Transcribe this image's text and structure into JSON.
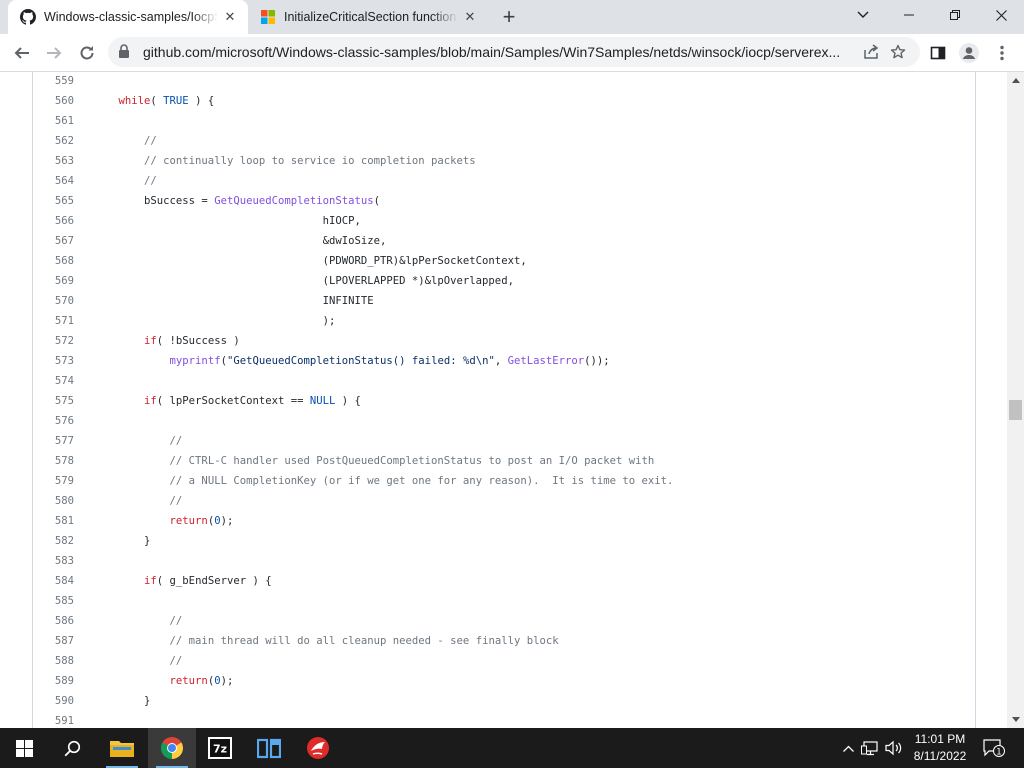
{
  "browser": {
    "tabs": [
      {
        "title": "Windows-classic-samples/IocpServerEx",
        "favicon": "github-icon",
        "active": true
      },
      {
        "title": "InitializeCriticalSection function (synchapi.h)",
        "favicon": "microsoft-icon",
        "active": false
      }
    ],
    "new_tab_label": "+",
    "close_tab_label": "✕",
    "window_controls": [
      "minimize",
      "restore",
      "close"
    ],
    "url": "github.com/microsoft/Windows-classic-samples/blob/main/Samples/Win7Samples/netds/winsock/iocp/serverex..."
  },
  "code": {
    "lines": [
      {
        "n": "559",
        "tokens": []
      },
      {
        "n": "560",
        "tokens": [
          {
            "t": "    "
          },
          {
            "t": "while",
            "c": "kw"
          },
          {
            "t": "( "
          },
          {
            "t": "TRUE",
            "c": "const"
          },
          {
            "t": " ) {"
          }
        ]
      },
      {
        "n": "561",
        "tokens": []
      },
      {
        "n": "562",
        "tokens": [
          {
            "t": "        "
          },
          {
            "t": "//",
            "c": "com"
          }
        ]
      },
      {
        "n": "563",
        "tokens": [
          {
            "t": "        "
          },
          {
            "t": "// continually loop to service io completion packets",
            "c": "com"
          }
        ]
      },
      {
        "n": "564",
        "tokens": [
          {
            "t": "        "
          },
          {
            "t": "//",
            "c": "com"
          }
        ]
      },
      {
        "n": "565",
        "tokens": [
          {
            "t": "        bSuccess = "
          },
          {
            "t": "GetQueuedCompletionStatus",
            "c": "fn"
          },
          {
            "t": "("
          }
        ]
      },
      {
        "n": "566",
        "tokens": [
          {
            "t": "                                    hIOCP,"
          }
        ]
      },
      {
        "n": "567",
        "tokens": [
          {
            "t": "                                    &dwIoSize,"
          }
        ]
      },
      {
        "n": "568",
        "tokens": [
          {
            "t": "                                    (PDWORD_PTR)&lpPerSocketContext,"
          }
        ]
      },
      {
        "n": "569",
        "tokens": [
          {
            "t": "                                    (LPOVERLAPPED *)&lpOverlapped,"
          }
        ]
      },
      {
        "n": "570",
        "tokens": [
          {
            "t": "                                    INFINITE"
          }
        ]
      },
      {
        "n": "571",
        "tokens": [
          {
            "t": "                                    );"
          }
        ]
      },
      {
        "n": "572",
        "tokens": [
          {
            "t": "        "
          },
          {
            "t": "if",
            "c": "kw"
          },
          {
            "t": "( !bSuccess )"
          }
        ]
      },
      {
        "n": "573",
        "tokens": [
          {
            "t": "            "
          },
          {
            "t": "myprintf",
            "c": "fn"
          },
          {
            "t": "(",
            "c": "plain"
          },
          {
            "t": "\"GetQueuedCompletionStatus() failed: %d\\n\"",
            "c": "str"
          },
          {
            "t": ", "
          },
          {
            "t": "GetLastError",
            "c": "fn"
          },
          {
            "t": "());"
          }
        ]
      },
      {
        "n": "574",
        "tokens": []
      },
      {
        "n": "575",
        "tokens": [
          {
            "t": "        "
          },
          {
            "t": "if",
            "c": "kw"
          },
          {
            "t": "( lpPerSocketContext == "
          },
          {
            "t": "NULL",
            "c": "const"
          },
          {
            "t": " ) {"
          }
        ]
      },
      {
        "n": "576",
        "tokens": []
      },
      {
        "n": "577",
        "tokens": [
          {
            "t": "            "
          },
          {
            "t": "//",
            "c": "com"
          }
        ]
      },
      {
        "n": "578",
        "tokens": [
          {
            "t": "            "
          },
          {
            "t": "// CTRL-C handler used PostQueuedCompletionStatus to post an I/O packet with",
            "c": "com"
          }
        ]
      },
      {
        "n": "579",
        "tokens": [
          {
            "t": "            "
          },
          {
            "t": "// a NULL CompletionKey (or if we get one for any reason).  It is time to exit.",
            "c": "com"
          }
        ]
      },
      {
        "n": "580",
        "tokens": [
          {
            "t": "            "
          },
          {
            "t": "//",
            "c": "com"
          }
        ]
      },
      {
        "n": "581",
        "tokens": [
          {
            "t": "            "
          },
          {
            "t": "return",
            "c": "kw"
          },
          {
            "t": "("
          },
          {
            "t": "0",
            "c": "const"
          },
          {
            "t": ");"
          }
        ]
      },
      {
        "n": "582",
        "tokens": [
          {
            "t": "        }"
          }
        ]
      },
      {
        "n": "583",
        "tokens": []
      },
      {
        "n": "584",
        "tokens": [
          {
            "t": "        "
          },
          {
            "t": "if",
            "c": "kw"
          },
          {
            "t": "( g_bEndServer ) {"
          }
        ]
      },
      {
        "n": "585",
        "tokens": []
      },
      {
        "n": "586",
        "tokens": [
          {
            "t": "            "
          },
          {
            "t": "//",
            "c": "com"
          }
        ]
      },
      {
        "n": "587",
        "tokens": [
          {
            "t": "            "
          },
          {
            "t": "// main thread will do all cleanup needed - see finally block",
            "c": "com"
          }
        ]
      },
      {
        "n": "588",
        "tokens": [
          {
            "t": "            "
          },
          {
            "t": "//",
            "c": "com"
          }
        ]
      },
      {
        "n": "589",
        "tokens": [
          {
            "t": "            "
          },
          {
            "t": "return",
            "c": "kw"
          },
          {
            "t": "("
          },
          {
            "t": "0",
            "c": "const"
          },
          {
            "t": ");"
          }
        ]
      },
      {
        "n": "590",
        "tokens": [
          {
            "t": "        }"
          }
        ]
      },
      {
        "n": "591",
        "tokens": []
      }
    ]
  },
  "taskbar": {
    "apps": [
      "start-icon",
      "search-icon",
      "file-explorer-icon",
      "chrome-icon",
      "7zip-icon",
      "app-icon",
      "app-red-icon"
    ],
    "time": "11:01 PM",
    "date": "8/11/2022",
    "notification_count": "1"
  },
  "colors": {
    "keyword": "#cf222e",
    "constant": "#0550ae",
    "comment": "#6e7781",
    "function": "#8250df",
    "string": "#0a3069",
    "taskbar": "#1b1b1b"
  }
}
